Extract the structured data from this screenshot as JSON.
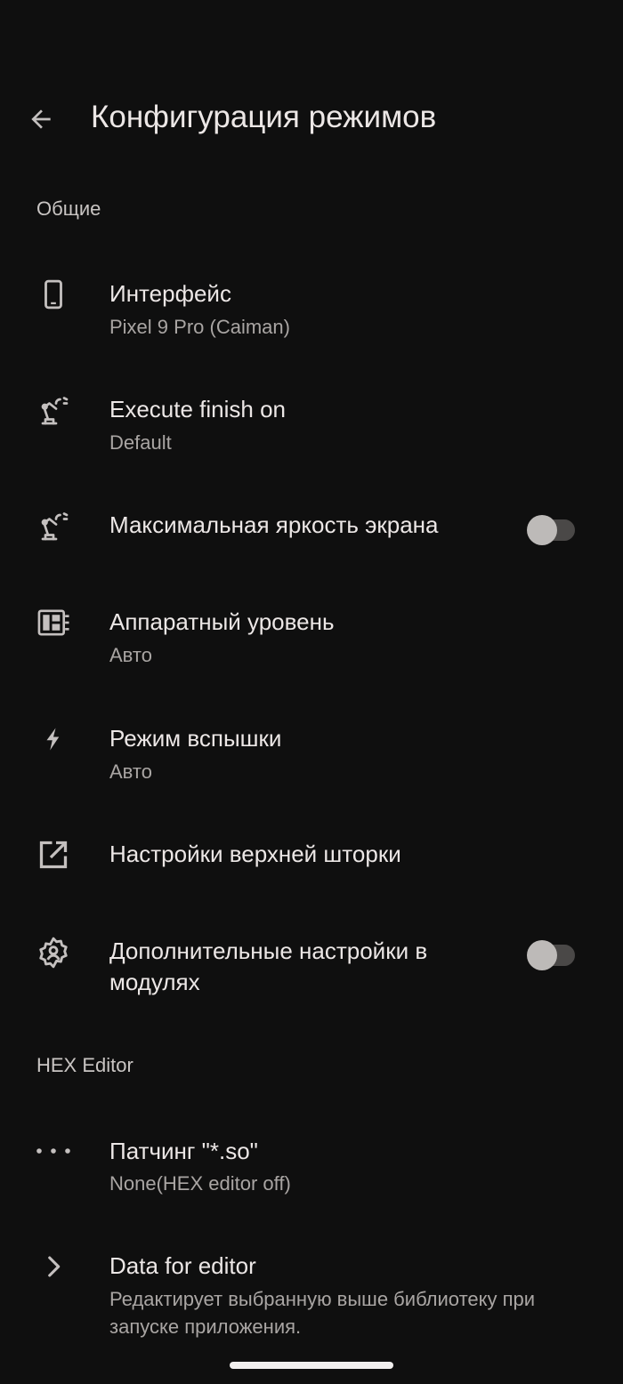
{
  "header": {
    "title": "Конфигурация режимов",
    "back_icon": "arrow-back-icon"
  },
  "sections": {
    "general": "Общие",
    "hex_editor": "HEX Editor"
  },
  "items": {
    "interface": {
      "title": "Интерфейс",
      "summary": "Pixel 9 Pro (Caiman)",
      "icon": "phone-icon"
    },
    "execute_finish": {
      "title": "Execute finish on",
      "summary": "Default",
      "icon": "robot-arm-icon"
    },
    "max_brightness": {
      "title": "Максимальная яркость экрана",
      "icon": "robot-arm-icon",
      "toggle_on": false
    },
    "hardware_level": {
      "title": "Аппаратный уровень",
      "summary": "Авто",
      "icon": "chip-icon"
    },
    "flash_mode": {
      "title": "Режим вспышки",
      "summary": "Авто",
      "icon": "flash-icon"
    },
    "top_shade": {
      "title": "Настройки верхней шторки",
      "icon": "open-in-new-icon"
    },
    "extra_modules": {
      "title_line1": "Дополнительные настройки в",
      "title_line2": "модулях",
      "icon": "module-gear-icon",
      "toggle_on": false
    },
    "patching": {
      "title": "Патчинг \"*.so\"",
      "summary": "None(HEX editor off)",
      "icon": "more-horiz-icon"
    },
    "data_editor": {
      "title": "Data for editor",
      "summary_line1": "Редактирует выбранную выше библиотеку при",
      "summary_line2": "запуске приложения.",
      "icon": "chevron-right-icon"
    }
  },
  "colors": {
    "background": "#0f0f0f",
    "text_primary": "#ece7e6",
    "text_secondary": "#a9a5a3",
    "icon": "#c4c0bf",
    "switch_track_off": "#4a4847",
    "switch_thumb_off": "#bdbab8"
  }
}
